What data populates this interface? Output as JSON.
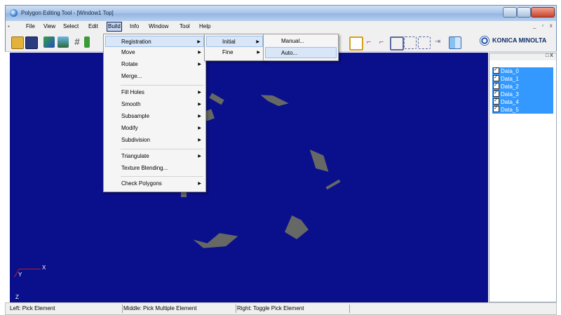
{
  "window": {
    "title": "Polygon Editing Tool - [Window1 Top]"
  },
  "menubar": {
    "items": [
      "File",
      "View",
      "Select",
      "Edit",
      "Build",
      "Info",
      "Window",
      "Tool",
      "Help"
    ],
    "active": "Build"
  },
  "brand": {
    "logo_text": "KONICA MINOLTA"
  },
  "build_menu": {
    "items": [
      "Registration",
      "Move",
      "Rotate",
      "Merge...",
      "Fill Holes",
      "Smooth",
      "Subsample",
      "Modify",
      "Subdivision",
      "Triangulate",
      "Texture Blending...",
      "Check Polygons"
    ]
  },
  "registration_menu": {
    "items": [
      "Initial",
      "Fine"
    ]
  },
  "initial_menu": {
    "items": [
      "Manual...",
      "Auto..."
    ]
  },
  "viewport": {
    "axis_x": "X",
    "axis_y": "Y",
    "axis_z": "Z"
  },
  "data_panel": {
    "close": "□ X",
    "items": [
      "Data_0",
      "Data_1",
      "Data_2",
      "Data_3",
      "Data_4",
      "Data_5"
    ]
  },
  "statusbar": {
    "left": "Left: Pick Element",
    "middle": "Middle: Pick Multiple Element",
    "right": "Right: Toggle Pick Element"
  },
  "colors": {
    "viewport_bg": "#0a0f8c",
    "selection": "#3399ff",
    "menu_highlight": "#d9e6f8"
  },
  "toolbar_icons": [
    "open-icon",
    "save-icon",
    "brush-icon",
    "stack-icon",
    "grid-icon",
    "mesh-icon",
    "select-box-icon",
    "select-pink-icon",
    "select-pink2-icon",
    "group-icon",
    "dotted-select-icon",
    "dotted-select2-icon",
    "arrow-select-icon",
    "layout-icon"
  ]
}
